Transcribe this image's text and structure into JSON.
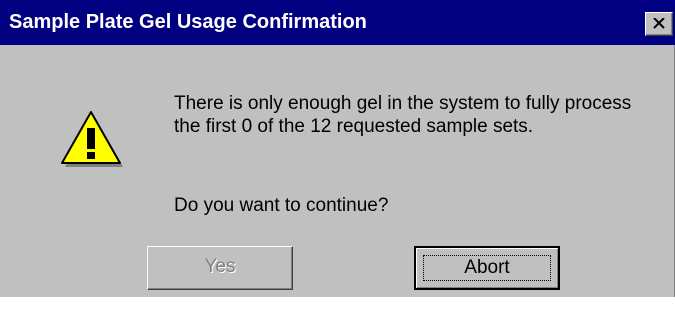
{
  "window": {
    "title": "Sample Plate Gel Usage Confirmation",
    "close_icon": "close-icon"
  },
  "message": {
    "icon": "warning-icon",
    "text": "There is only enough gel in the system to fully process the first 0 of the 12 requested sample sets.",
    "question": "Do you want to continue?"
  },
  "buttons": {
    "yes_label": "Yes",
    "yes_enabled": false,
    "abort_label": "Abort",
    "abort_default": true
  },
  "colors": {
    "titlebar": "#000080",
    "dialog_face": "#c0c0c0",
    "warning_yellow": "#ffff00"
  }
}
